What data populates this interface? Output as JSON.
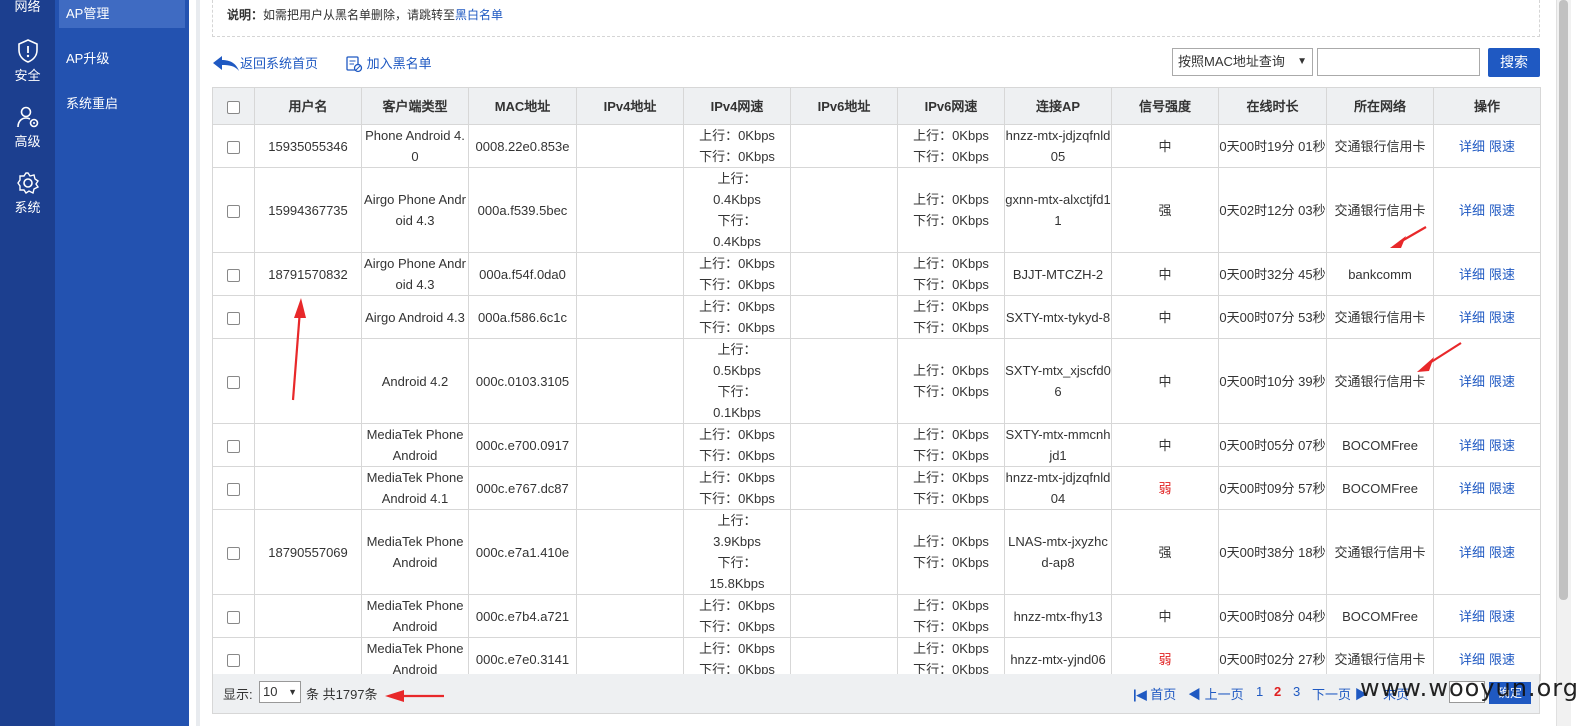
{
  "rail": {
    "items": [
      {
        "label": "网络",
        "icon": "network-icon"
      },
      {
        "label": "安全",
        "icon": "shield-icon"
      },
      {
        "label": "高级",
        "icon": "user-gear-icon"
      },
      {
        "label": "系统",
        "icon": "gear-icon"
      }
    ]
  },
  "submenu": {
    "items": [
      {
        "label": "AP管理",
        "active": true
      },
      {
        "label": "AP升级",
        "active": false
      },
      {
        "label": "系统重启",
        "active": false
      }
    ]
  },
  "notice": {
    "prefix": "说明：",
    "text": "如需把用户从黑名单删除，请跳转至",
    "link": "黑白名单"
  },
  "toolbar": {
    "back_label": "返回系统首页",
    "blacklist_label": "加入黑名单",
    "search_mode": "按照MAC地址查询",
    "search_value": "",
    "search_button": "搜索"
  },
  "table": {
    "headers": [
      "",
      "用户名",
      "客户端类型",
      "MAC地址",
      "IPv4地址",
      "IPv4网速",
      "IPv6地址",
      "IPv6网速",
      "连接AP",
      "信号强度",
      "在线时长",
      "所在网络",
      "操作"
    ],
    "rows": [
      {
        "user": "15935055346",
        "client": "Phone Android 4.0",
        "mac": "0008.22e0.853e",
        "ipv4": "",
        "ipv4_speed": "上行：0Kbps\n下行：0Kbps",
        "ipv6": "",
        "ipv6_speed": "上行：0Kbps\n下行：0Kbps",
        "ap": "hnzz-mtx-jdjzqfnld05",
        "signal": "中",
        "online": "0天00时19分 01秒",
        "network": "交通银行信用卡"
      },
      {
        "user": "15994367735",
        "client": "Airgo Phone Android 4.3",
        "mac": "000a.f539.5bec",
        "ipv4": "",
        "ipv4_speed": "上行：\n0.4Kbps\n下行：\n0.4Kbps",
        "ipv6": "",
        "ipv6_speed": "上行：0Kbps\n下行：0Kbps",
        "ap": "gxnn-mtx-alxctjfd11",
        "signal": "强",
        "online": "0天02时12分 03秒",
        "network": "交通银行信用卡"
      },
      {
        "user": "18791570832",
        "client": "Airgo Phone Android 4.3",
        "mac": "000a.f54f.0da0",
        "ipv4": "",
        "ipv4_speed": "上行：0Kbps\n下行：0Kbps",
        "ipv6": "",
        "ipv6_speed": "上行：0Kbps\n下行：0Kbps",
        "ap": "BJJT-MTCZH-2",
        "signal": "中",
        "online": "0天00时32分 45秒",
        "network": "bankcomm"
      },
      {
        "user": "",
        "client": "Airgo Android 4.3",
        "mac": "000a.f586.6c1c",
        "ipv4": "",
        "ipv4_speed": "上行：0Kbps\n下行：0Kbps",
        "ipv6": "",
        "ipv6_speed": "上行：0Kbps\n下行：0Kbps",
        "ap": "SXTY-mtx-tykyd-8",
        "signal": "中",
        "online": "0天00时07分 53秒",
        "network": "交通银行信用卡"
      },
      {
        "user": "",
        "client": "Android 4.2",
        "mac": "000c.0103.3105",
        "ipv4": "",
        "ipv4_speed": "上行：\n0.5Kbps\n下行：\n0.1Kbps",
        "ipv6": "",
        "ipv6_speed": "上行：0Kbps\n下行：0Kbps",
        "ap": "SXTY-mtx_xjscfd06",
        "signal": "中",
        "online": "0天00时10分 39秒",
        "network": "交通银行信用卡"
      },
      {
        "user": "",
        "client": "MediaTek Phone Android",
        "mac": "000c.e700.0917",
        "ipv4": "",
        "ipv4_speed": "上行：0Kbps\n下行：0Kbps",
        "ipv6": "",
        "ipv6_speed": "上行：0Kbps\n下行：0Kbps",
        "ap": "SXTY-mtx-mmcnhjd1",
        "signal": "中",
        "online": "0天00时05分 07秒",
        "network": "BOCOMFree"
      },
      {
        "user": "",
        "client": "MediaTek Phone Android 4.1",
        "mac": "000c.e767.dc87",
        "ipv4": "",
        "ipv4_speed": "上行：0Kbps\n下行：0Kbps",
        "ipv6": "",
        "ipv6_speed": "上行：0Kbps\n下行：0Kbps",
        "ap": "hnzz-mtx-jdjzqfnld04",
        "signal": "弱",
        "online": "0天00时09分 57秒",
        "network": "BOCOMFree"
      },
      {
        "user": "18790557069",
        "client": "MediaTek Phone Android",
        "mac": "000c.e7a1.410e",
        "ipv4": "",
        "ipv4_speed": "上行：\n3.9Kbps\n下行：\n15.8Kbps",
        "ipv6": "",
        "ipv6_speed": "上行：0Kbps\n下行：0Kbps",
        "ap": "LNAS-mtx-jxyzhcd-ap8",
        "signal": "强",
        "online": "0天00时38分 18秒",
        "network": "交通银行信用卡"
      },
      {
        "user": "",
        "client": "MediaTek Phone Android",
        "mac": "000c.e7b4.a721",
        "ipv4": "",
        "ipv4_speed": "上行：0Kbps\n下行：0Kbps",
        "ipv6": "",
        "ipv6_speed": "上行：0Kbps\n下行：0Kbps",
        "ap": "hnzz-mtx-fhy13",
        "signal": "中",
        "online": "0天00时08分 04秒",
        "network": "BOCOMFree"
      },
      {
        "user": "",
        "client": "MediaTek Phone Android",
        "mac": "000c.e7e0.3141",
        "ipv4": "",
        "ipv4_speed": "上行：0Kbps\n下行：0Kbps",
        "ipv6": "",
        "ipv6_speed": "上行：0Kbps\n下行：0Kbps",
        "ap": "hnzz-mtx-yjnd06",
        "signal": "弱",
        "online": "0天00时02分 27秒",
        "network": "交通银行信用卡"
      }
    ],
    "op_detail": "详细",
    "op_limit": "限速"
  },
  "pager": {
    "show_label": "显示:",
    "page_size": "10",
    "total_text": "条 共1797条",
    "first": "首页",
    "prev": "上一页",
    "pages": [
      "1",
      "2",
      "3"
    ],
    "current": "2",
    "next": "下一页",
    "last": "末页",
    "goto": "确定"
  },
  "watermark": "www.wooyun.org",
  "colors": {
    "accent": "#1f59c2",
    "rail": "#1c3f8f",
    "submenu": "#2352b0",
    "weak_signal": "#e02020",
    "annotation_arrow": "#e8282a"
  }
}
